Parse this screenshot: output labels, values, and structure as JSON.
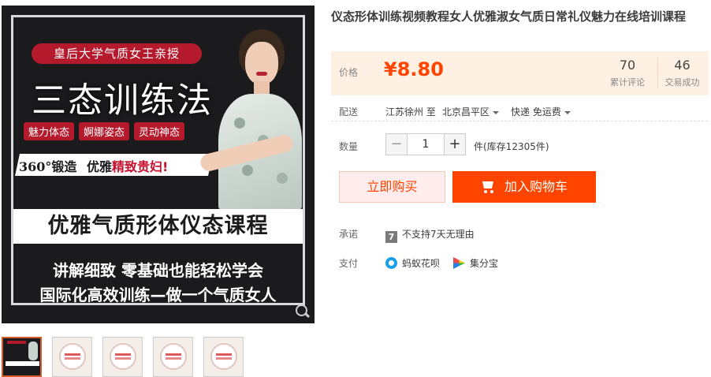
{
  "gallery": {
    "banner": {
      "ribbon": "皇后大学气质女王亲授",
      "headline": "三态训练法",
      "tags": [
        "魅力体态",
        "婀娜姿态",
        "灵动神态"
      ],
      "slogan_prefix": "360°锻造",
      "slogan_main_a": "优雅",
      "slogan_main_b": "精致贵妇!",
      "course_title": "优雅气质形体仪态课程",
      "promo_line1": "讲解细致 零基础也能轻松学会",
      "promo_line2": "国际化高效训练—做一个气质女人"
    },
    "zoom_icon": "magnifier-icon",
    "thumbnails": [
      {
        "active": true
      },
      {
        "active": false
      },
      {
        "active": false
      },
      {
        "active": false
      },
      {
        "active": false
      }
    ]
  },
  "product": {
    "title": "仪态形体训练视频教程女人优雅淑女气质日常礼仪魅力在线培训课程",
    "price_label": "价格",
    "price": "¥8.80",
    "reviews_count": "70",
    "reviews_label": "累计评论",
    "deals_count": "46",
    "deals_label": "交易成功",
    "delivery_label": "配送",
    "delivery_from": "江苏徐州 至",
    "delivery_to": "北京昌平区",
    "shipping": "快递 免运费",
    "quantity_label": "数量",
    "quantity_value": "1",
    "quantity_minus": "−",
    "quantity_plus": "+",
    "stock_text": "件(库存12305件)",
    "buy_now": "立即购买",
    "add_to_cart": "加入购物车",
    "promise_label": "承诺",
    "promise_badge": "7",
    "promise_text": "不支持7天无理由",
    "payment_label": "支付",
    "pay_methods": [
      "蚂蚁花呗",
      "集分宝"
    ]
  },
  "colors": {
    "accent": "#ff4400",
    "price_bg": "#fef0e3",
    "buy_bg": "#ffeded",
    "banner_red": "#b41a2c"
  }
}
